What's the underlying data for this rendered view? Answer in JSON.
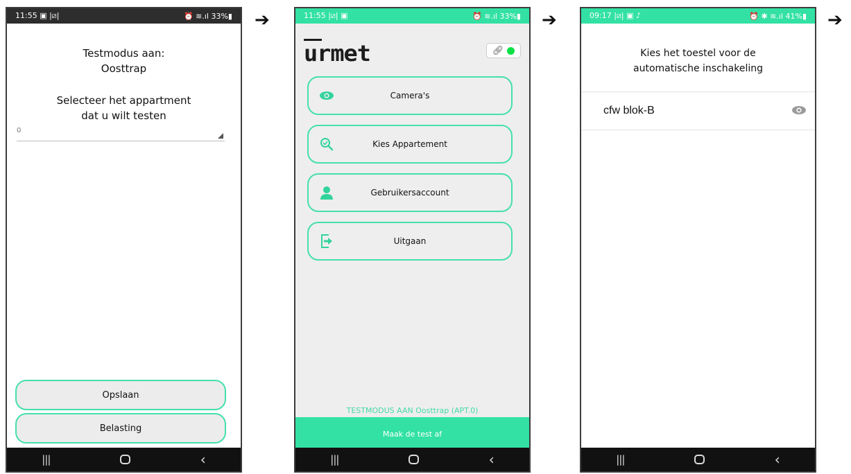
{
  "arrows": [
    "➔",
    "➔",
    "➔"
  ],
  "panel1": {
    "status": {
      "time": "11:55 ▣ |⧄|",
      "right": "⏰ ≋.ıl 33%▮"
    },
    "title_line1": "Testmodus aan:",
    "title_line2": "Oosttrap",
    "select_title_line1": "Selecteer het appartment",
    "select_title_line2": "dat u wilt testen",
    "select_value": "0",
    "save_label": "Opslaan",
    "load_label": "Belasting"
  },
  "panel2": {
    "status": {
      "time": "11:55 |⧄| ▣",
      "right": "⏰ ≋.ıl 33%▮"
    },
    "logo": "urmet",
    "menu": [
      {
        "label": "Camera's",
        "icon": "eye-icon"
      },
      {
        "label": "Kies Appartement",
        "icon": "search-check-icon"
      },
      {
        "label": "Gebruikersaccount",
        "icon": "user-icon"
      },
      {
        "label": "Uitgaan",
        "icon": "exit-icon"
      }
    ],
    "test_status": "TESTMODUS AAN Oosttrap (APT.0)",
    "finish_label": "Maak de test af"
  },
  "panel3": {
    "status": {
      "time": "09:17 |⧄| ▣ ♪",
      "right": "⏰ ✱ ≋.ıl 41%▮"
    },
    "title_line1": "Kies het toestel voor de",
    "title_line2": "automatische inschakeling",
    "device": "cfw blok-B"
  },
  "colors": {
    "accent": "#33e1a5",
    "accent_border": "#45dfae",
    "status_dark": "#2d2d2d",
    "connection_dot": "#0ae046"
  }
}
